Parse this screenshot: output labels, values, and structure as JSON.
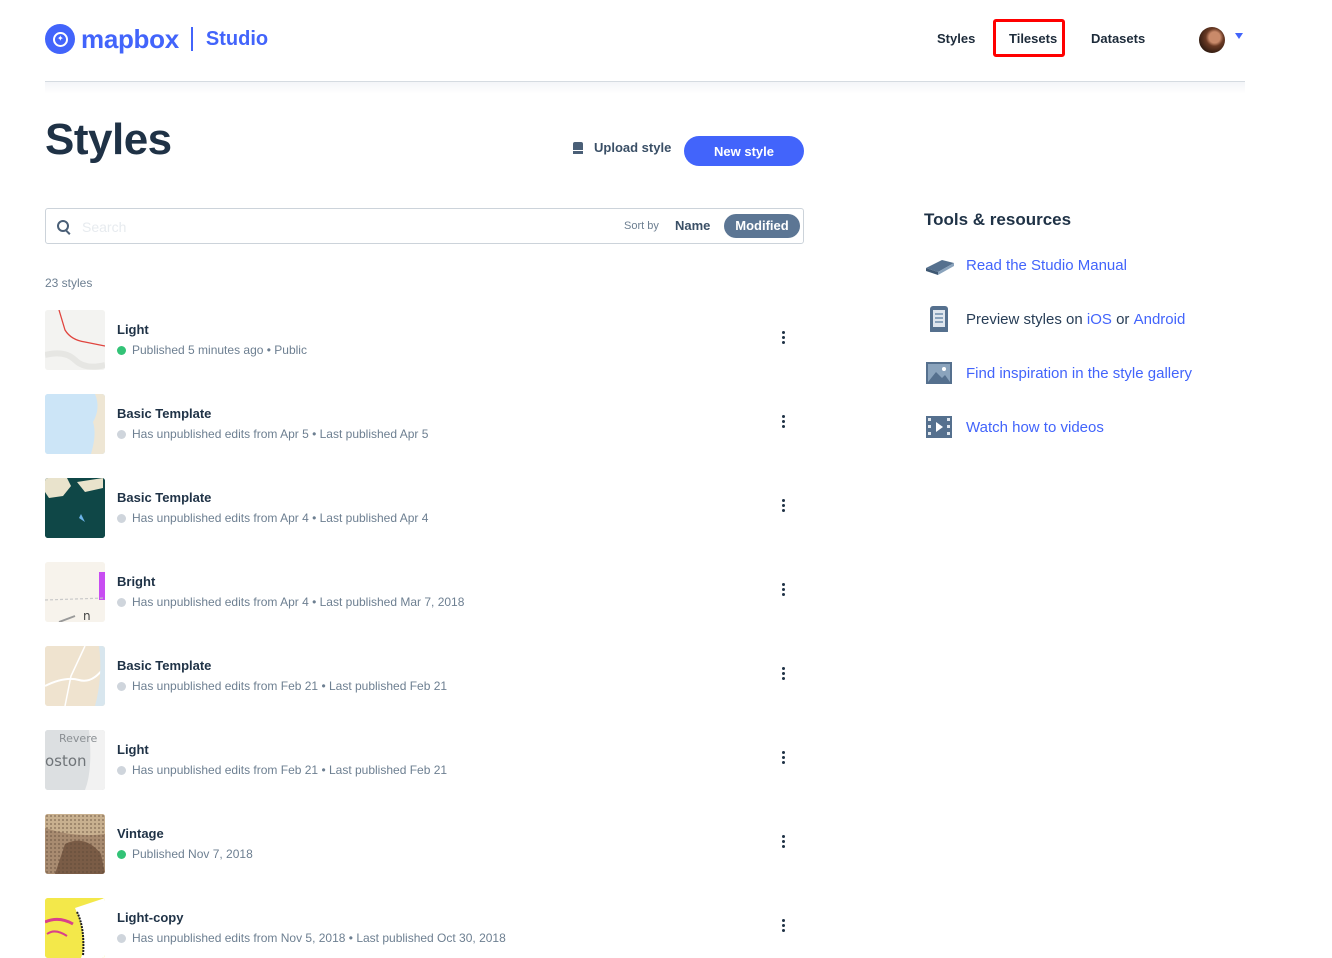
{
  "header": {
    "logo_text": "mapbox",
    "product": "Studio",
    "nav": {
      "styles": "Styles",
      "tilesets": "Tilesets",
      "datasets": "Datasets"
    },
    "highlight_color": "#ff0000"
  },
  "page": {
    "title": "Styles",
    "upload_label": "Upload style",
    "new_style_label": "New style",
    "accent_color": "#4264fb"
  },
  "search": {
    "placeholder": "Search",
    "value": "",
    "sort_by_label": "Sort by",
    "sort_options": [
      "Name",
      "Modified"
    ],
    "sort_selected": "Modified"
  },
  "count_label": "23 styles",
  "styles": [
    {
      "name": "Light",
      "status": "Published 5 minutes ago • Public",
      "published": true,
      "thumb": "light-map"
    },
    {
      "name": "Basic Template",
      "status": "Has unpublished edits from Apr 5 • Last published Apr 5",
      "published": false,
      "thumb": "basic-blue-map"
    },
    {
      "name": "Basic Template",
      "status": "Has unpublished edits from Apr 4 • Last published Apr 4",
      "published": false,
      "thumb": "dark-teal-map"
    },
    {
      "name": "Bright",
      "status": "Has unpublished edits from Apr 4 • Last published Mar 7, 2018",
      "published": false,
      "thumb": "bright-map",
      "thumb_label": "n"
    },
    {
      "name": "Basic Template",
      "status": "Has unpublished edits from Feb 21 • Last published Feb 21",
      "published": false,
      "thumb": "basic-tan-map"
    },
    {
      "name": "Light",
      "status": "Has unpublished edits from Feb 21 • Last published Feb 21",
      "published": false,
      "thumb": "light-boston-map",
      "thumb_labels": [
        "Revere",
        "oston"
      ]
    },
    {
      "name": "Vintage",
      "status": "Published Nov 7, 2018",
      "published": true,
      "thumb": "vintage-map"
    },
    {
      "name": "Light-copy",
      "status": "Has unpublished edits from Nov 5, 2018 • Last published Oct 30, 2018",
      "published": false,
      "thumb": "yellow-map"
    }
  ],
  "resources": {
    "title": "Tools & resources",
    "manual": "Read the Studio Manual",
    "preview_prefix": "Preview styles on",
    "preview_ios": "iOS",
    "preview_or": "or",
    "preview_android": "Android",
    "gallery": "Find inspiration in the style gallery",
    "videos": "Watch how to videos"
  }
}
